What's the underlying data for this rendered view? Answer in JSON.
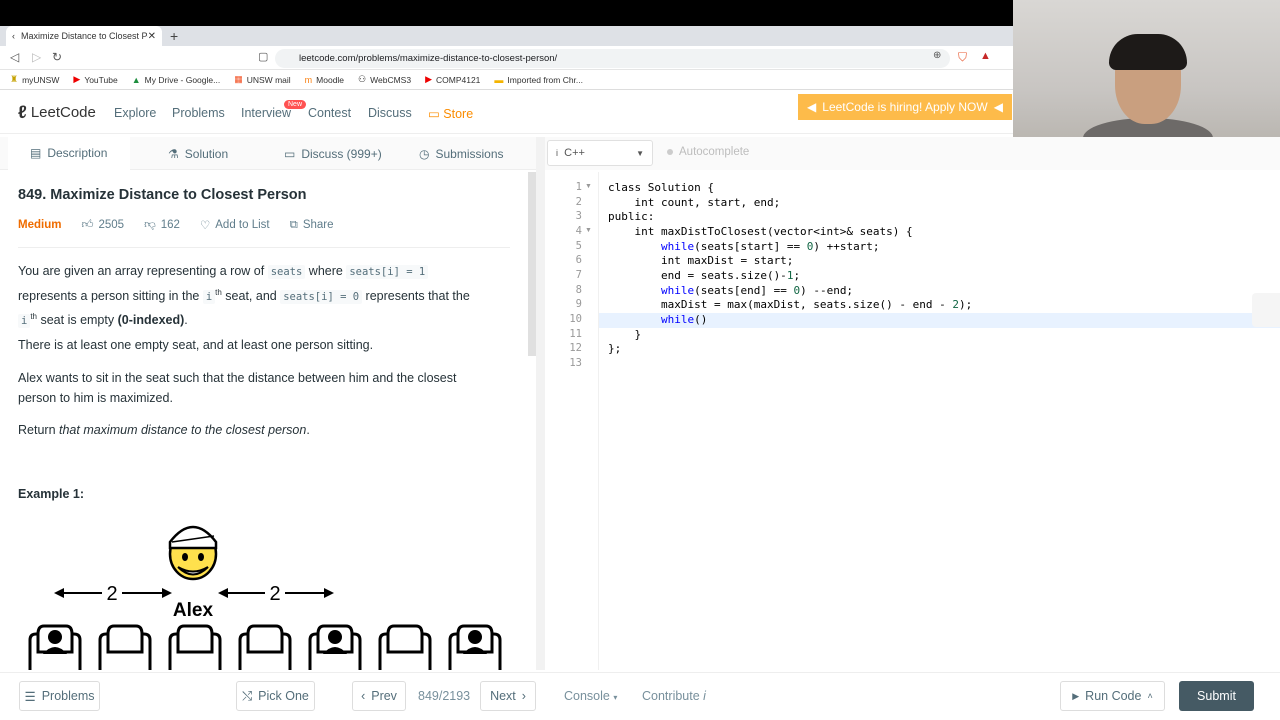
{
  "browser": {
    "tab_title": "Maximize Distance to Closest Per",
    "url": "leetcode.com/problems/maximize-distance-to-closest-person/",
    "bookmarks": [
      "myUNSW",
      "YouTube",
      "My Drive - Google...",
      "UNSW mail",
      "Moodle",
      "WebCMS3",
      "COMP4121",
      "Imported from Chr..."
    ]
  },
  "header": {
    "logo_text": "LeetCode",
    "nav": [
      "Explore",
      "Problems",
      "Interview",
      "Contest",
      "Discuss",
      "Store"
    ],
    "new_badge": "New",
    "hiring_banner": "LeetCode is hiring! Apply NOW"
  },
  "left_tabs": [
    "Description",
    "Solution",
    "Discuss (999+)",
    "Submissions"
  ],
  "editor_toolbar": {
    "language": "C++",
    "autocomplete": "Autocomplete"
  },
  "problem": {
    "title": "849. Maximize Distance to Closest Person",
    "difficulty": "Medium",
    "likes": "2505",
    "dislikes": "162",
    "add_to_list": "Add to List",
    "share": "Share",
    "p1_a": "You are given an array representing a row of ",
    "p1_code1": "seats",
    "p1_b": " where ",
    "p1_code2": "seats[i] = 1",
    "p1_c": "represents a person sitting in the ",
    "p1_code3": "i",
    "p1_sup": "th",
    "p1_d": " seat, and ",
    "p1_code4": "seats[i] = 0",
    "p1_e": " represents that the",
    "p1_code5": "i",
    "p1_sup2": "th",
    "p1_f": " seat is empty ",
    "p1_bold": "(0-indexed)",
    "p1_g": ".",
    "p2": "There is at least one empty seat, and at least one person sitting.",
    "p3": "Alex wants to sit in the seat such that the distance between him and the closest person to him is maximized.",
    "p4_a": "Return ",
    "p4_em": "that maximum distance to the closest person",
    "p4_b": ".",
    "example_label": "Example 1:",
    "fig_left_num": "2",
    "fig_right_num": "2",
    "fig_name": "Alex"
  },
  "code_lines": [
    "class Solution {",
    "    int count, start, end;",
    "public:",
    "    int maxDistToClosest(vector<int>& seats) {",
    "        while(seats[start] == 0) ++start;",
    "        int maxDist = start;",
    "        end = seats.size()-1;",
    "        while(seats[end] == 0) --end;",
    "        maxDist = max(maxDist, seats.size() - end - 2);",
    "        while()",
    "    }",
    "};",
    ""
  ],
  "line_numbers": [
    "1",
    "2",
    "3",
    "4",
    "5",
    "6",
    "7",
    "8",
    "9",
    "10",
    "11",
    "12",
    "13"
  ],
  "footer": {
    "problems": "Problems",
    "pick_one": "Pick One",
    "prev": "Prev",
    "page": "849/2193",
    "next": "Next",
    "console": "Console",
    "contribute": "Contribute",
    "run_code": "Run Code",
    "submit": "Submit"
  }
}
